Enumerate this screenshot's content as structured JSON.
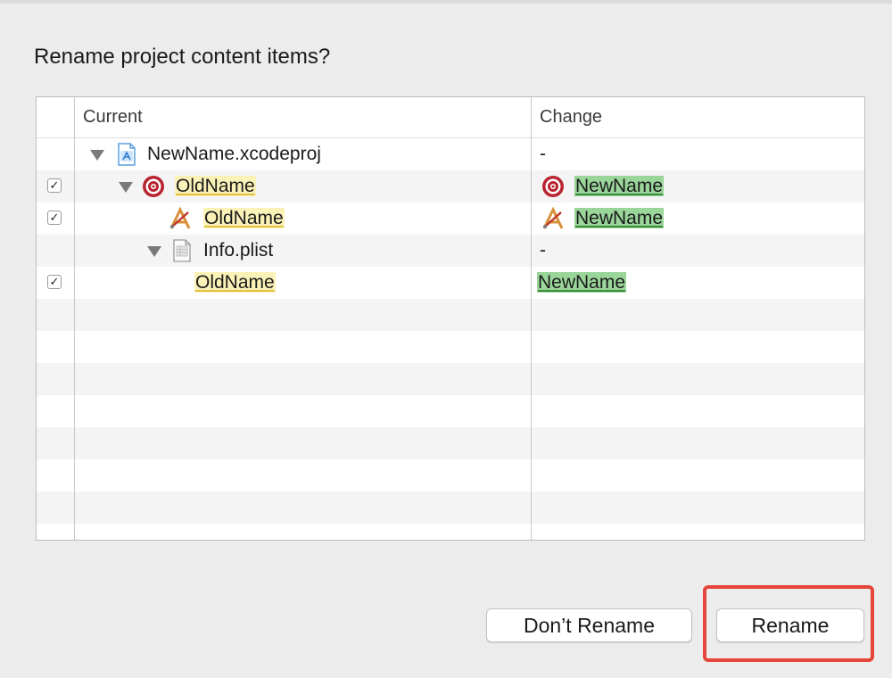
{
  "dialog": {
    "title": "Rename project content items?"
  },
  "table": {
    "columns": {
      "current": "Current",
      "change": "Change"
    },
    "rows": [
      {
        "checked": null,
        "current": "NewName.xcodeproj",
        "change": "-"
      },
      {
        "checked": true,
        "current": "OldName",
        "change": "NewName"
      },
      {
        "checked": true,
        "current": "OldName",
        "change": "NewName"
      },
      {
        "checked": null,
        "current": "Info.plist",
        "change": "-"
      },
      {
        "checked": true,
        "current": "OldName",
        "change": "NewName"
      }
    ],
    "checkmark": "✓"
  },
  "buttons": {
    "dont_rename": "Don’t Rename",
    "rename": "Rename"
  },
  "icons": {
    "project": "xcodeproj-file-icon",
    "target": "target-icon",
    "app": "application-icon",
    "plist": "plist-file-icon",
    "disclosure": "disclosure-triangle-icon"
  },
  "colors": {
    "old_highlight": "#fbf2b8",
    "new_highlight": "#9ad59a",
    "callout": "#e5453a"
  }
}
